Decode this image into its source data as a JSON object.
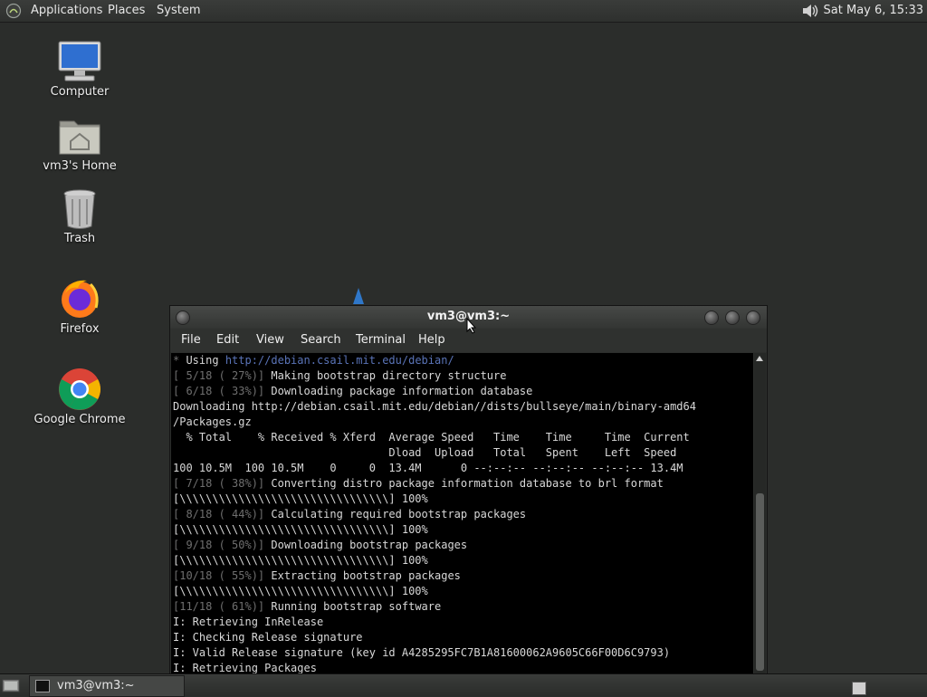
{
  "top_panel": {
    "menus": [
      "Applications",
      "Places",
      "System"
    ],
    "clock": "Sat May  6, 15:33",
    "icons": {
      "logo": "gnome-foot-icon",
      "volume": "speaker-icon"
    }
  },
  "desktop": {
    "icons": [
      {
        "label": "Computer",
        "icon": "computer-icon"
      },
      {
        "label": "vm3's Home",
        "icon": "home-folder-icon"
      },
      {
        "label": "Trash",
        "icon": "trash-icon"
      },
      {
        "label": "Firefox",
        "icon": "firefox-icon"
      },
      {
        "label": "Google Chrome",
        "icon": "chrome-icon"
      }
    ]
  },
  "terminal": {
    "title": "vm3@vm3:~",
    "menu": [
      "File",
      "Edit",
      "View",
      "Search",
      "Terminal",
      "Help"
    ],
    "lines": [
      {
        "dim": "* ",
        "text": "Using ",
        "link": "http://debian.csail.mit.edu/debian/"
      },
      {
        "dim": "[ 5/18 ( 27%)] ",
        "text": "Making bootstrap directory structure"
      },
      {
        "dim": "[ 6/18 ( 33%)] ",
        "text": "Downloading package information database"
      },
      {
        "dim": "",
        "text": "Downloading http://debian.csail.mit.edu/debian//dists/bullseye/main/binary-amd64"
      },
      {
        "dim": "",
        "text": "/Packages.gz"
      },
      {
        "dim": "",
        "text": "  % Total    % Received % Xferd  Average Speed   Time    Time     Time  Current"
      },
      {
        "dim": "",
        "text": "                                 Dload  Upload   Total   Spent    Left  Speed"
      },
      {
        "dim": "",
        "text": "100 10.5M  100 10.5M    0     0  13.4M      0 --:--:-- --:--:-- --:--:-- 13.4M"
      },
      {
        "dim": "[ 7/18 ( 38%)] ",
        "text": "Converting distro package information database to brl format"
      },
      {
        "dim": "",
        "text": "[\\\\\\\\\\\\\\\\\\\\\\\\\\\\\\\\\\\\\\\\\\\\\\\\\\\\\\\\\\\\\\\\] 100%"
      },
      {
        "dim": "[ 8/18 ( 44%)] ",
        "text": "Calculating required bootstrap packages"
      },
      {
        "dim": "",
        "text": "[\\\\\\\\\\\\\\\\\\\\\\\\\\\\\\\\\\\\\\\\\\\\\\\\\\\\\\\\\\\\\\\\] 100%"
      },
      {
        "dim": "[ 9/18 ( 50%)] ",
        "text": "Downloading bootstrap packages"
      },
      {
        "dim": "",
        "text": "[\\\\\\\\\\\\\\\\\\\\\\\\\\\\\\\\\\\\\\\\\\\\\\\\\\\\\\\\\\\\\\\\] 100%"
      },
      {
        "dim": "[10/18 ( 55%)] ",
        "text": "Extracting bootstrap packages"
      },
      {
        "dim": "",
        "text": "[\\\\\\\\\\\\\\\\\\\\\\\\\\\\\\\\\\\\\\\\\\\\\\\\\\\\\\\\\\\\\\\\] 100%"
      },
      {
        "dim": "[11/18 ( 61%)] ",
        "text": "Running bootstrap software"
      },
      {
        "dim": "",
        "text": "I: Retrieving InRelease"
      },
      {
        "dim": "",
        "text": "I: Checking Release signature"
      },
      {
        "dim": "",
        "text": "I: Valid Release signature (key id A4285295FC7B1A81600062A9605C66F00D6C9793)"
      },
      {
        "dim": "",
        "text": "I: Retrieving Packages"
      }
    ]
  },
  "bottom_panel": {
    "tasks": [
      {
        "label": "vm3@vm3:~",
        "icon": "terminal-icon"
      }
    ]
  },
  "colors": {
    "desktop_bg": "#2b2d2b",
    "terminal_bg": "#000000",
    "dim_text": "#6f6f6f",
    "link": "#5a74b8"
  }
}
